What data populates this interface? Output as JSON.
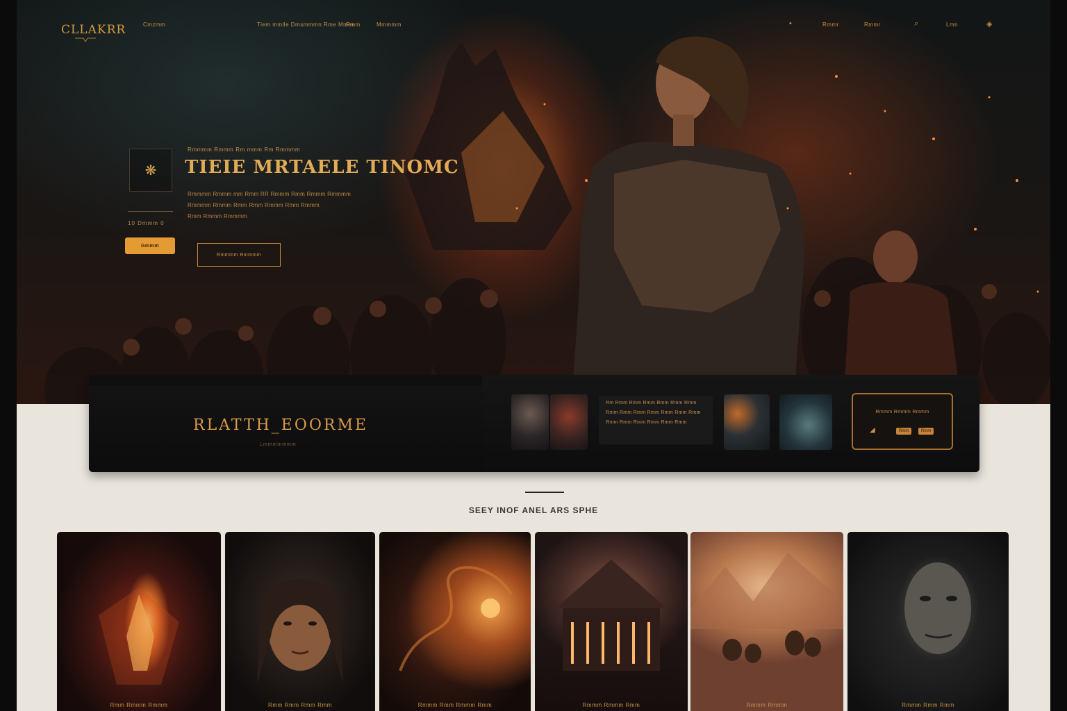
{
  "nav": {
    "logo": "CLLAKRR",
    "links_left": [
      "Cmzmm",
      "Tiem mmlle Dmsmmmn Rme Mmee",
      "Rmm",
      "Mmmmm"
    ],
    "links_right": [
      "Rmmr",
      "Rmmr"
    ],
    "right_label": "Lmn",
    "icons": [
      "search-icon",
      "bookmark-icon"
    ]
  },
  "hero": {
    "emblem_glyph": "❋",
    "eyebrow": "Rmmmm Rmmm Rm mmm Rm Rmmmm",
    "title": "TIEIE MRTAELE TINOMC",
    "description_lines": [
      "Rmmmm Rmmm mm Rmm RR Rmmm Rmm Rmmm Rmmmm",
      "Rmmmm Rmmm Rmm Rmm Rmmm Rmm Rmmm",
      "Rmm Rmmm Rmmmm"
    ],
    "meta": "10  Dmmm  0",
    "primary_button": "Gmmm",
    "outline_button": "Rmmmm Rmmmm"
  },
  "feature": {
    "title": "RLATTH_EOORME",
    "subtitle": "Lmmmmmmm",
    "text_lines": [
      "Rm Rmm Rmm Rmm Rmm Rmm Rmm",
      "Rmm Rmm Rmm Rmm Rmm Rmm Rmm",
      "Rmm Rmm Rmm Rmm Rmm Rmm"
    ],
    "promo_text": "Rmmm Rmmm Rmmm",
    "promo_chips": [
      "Rmm",
      "Rmm"
    ]
  },
  "section": {
    "heading": "SEEY INOF ANEL ARS SPHE",
    "cards": [
      {
        "caption": "Rmm Rmmm Rmmm"
      },
      {
        "caption": "Rmm Rmm Rmm Rmm"
      },
      {
        "caption": "Rmmm Rmm Rmmm Rmm"
      },
      {
        "caption": "Rmmm Rmmm Rmm"
      },
      {
        "caption": "Rmmm Rmmm"
      },
      {
        "caption": "Rmmm Rmm Rmm"
      }
    ]
  },
  "colors": {
    "accent": "#e59b34",
    "gold_text": "#d39a3e",
    "page_bg": "#e9e5dd",
    "hero_bg": "#121616"
  }
}
